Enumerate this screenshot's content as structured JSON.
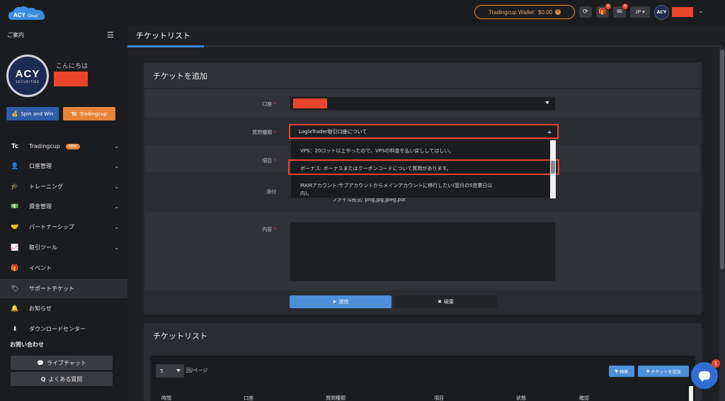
{
  "topbar": {
    "logo_text": "ACY",
    "logo_sub": "Cloud",
    "wallet_label": "Tradingcup Wallet:",
    "wallet_amount": "$0.00",
    "gift_count": "0",
    "mail_count": "0",
    "lang": "JP",
    "avatar_text": "ACY"
  },
  "sidebar": {
    "guide_label": "ご案内",
    "avatar_text": "ACY",
    "avatar_sub": "SECURITIES",
    "greeting": "こんにちは",
    "spin_label": "Spin and Win",
    "tradingcup_label": "Tradingcup",
    "nav": [
      {
        "label": "Tradingcup",
        "icon": "Tc",
        "badge": "NEW"
      },
      {
        "label": "口座管理",
        "icon": "👤"
      },
      {
        "label": "トレーニング",
        "icon": "🎓"
      },
      {
        "label": "資金管理",
        "icon": "💵"
      },
      {
        "label": "パートナーシップ",
        "icon": "🤝"
      },
      {
        "label": "取引ツール",
        "icon": "📈"
      },
      {
        "label": "イベント",
        "icon": "🎁"
      },
      {
        "label": "サポートチケット",
        "icon": "🏷"
      },
      {
        "label": "お知らせ",
        "icon": "🔔"
      },
      {
        "label": "ダウンロードセンター",
        "icon": "⬇"
      }
    ],
    "contact_heading": "お問い合わせ",
    "live_chat": "ライブチャット",
    "faq": "よくある質問"
  },
  "main": {
    "page_title": "チケットリスト",
    "add_panel_title": "チケットを追加",
    "labels": {
      "account": "口座",
      "question_type": "質問種類",
      "item": "項目",
      "attachment": "添付",
      "content": "内容"
    },
    "question_type_value": "LogixTrader取引口座について",
    "dropdown_options": [
      "VPS：20ロット以上やったので、VPSの料金を払い戻ししてほしい。",
      "ボーナス: ボーナスまたはクーポンコードについて質問があります。",
      "MAMアカウント:サブアカウントからメインアカウントに移行したい(翌月の5営業日以",
      "内)。"
    ],
    "file_note": "ファイル形式: png,jpg,jpeg,pdf",
    "submit": "送信",
    "discard": "破棄",
    "list_panel_title": "チケットリスト",
    "page_size": "5",
    "per_page": "回/ページ",
    "search": "検索",
    "add_ticket": "チケットを追加",
    "columns": [
      "時間",
      "口座",
      "質問種類",
      "項目",
      "状態",
      "確認"
    ]
  },
  "chat": {
    "badge": "1"
  },
  "colors": {
    "accent": "#4d8fd8",
    "orange": "#e8843a",
    "highlight_red": "#e2452f",
    "redaction": "#e8452c"
  }
}
